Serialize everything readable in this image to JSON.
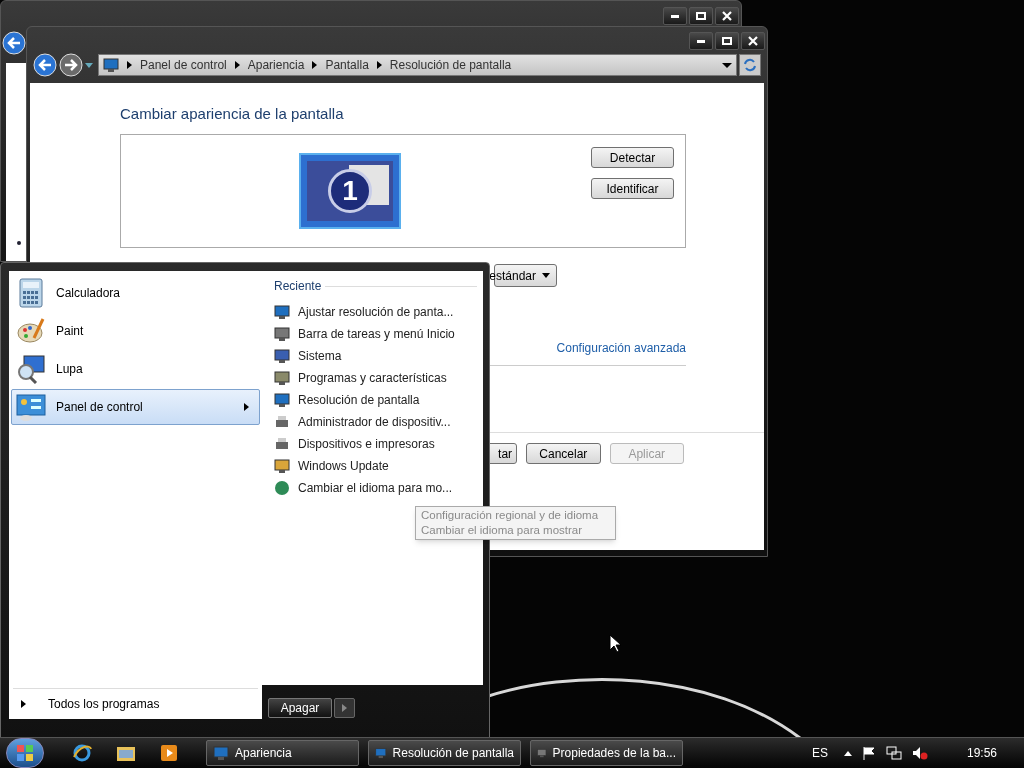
{
  "main_window": {
    "breadcrumb": [
      "Panel de control",
      "Apariencia",
      "Pantalla",
      "Resolución de pantalla"
    ],
    "heading": "Cambiar apariencia de la pantalla",
    "monitor_number": "1",
    "side_buttons": [
      "Detectar",
      "Identificar"
    ],
    "dropdown_value": "estándar",
    "link": "Configuración avanzada",
    "buttons": [
      {
        "label": "tar",
        "disabled": false
      },
      {
        "label": "Cancelar",
        "disabled": false
      },
      {
        "label": "Aplicar",
        "disabled": true
      }
    ]
  },
  "start_menu": {
    "pinned": [
      {
        "label": "Calculadora",
        "selected": false,
        "kind": "calculator"
      },
      {
        "label": "Paint",
        "selected": false,
        "kind": "paint"
      },
      {
        "label": "Lupa",
        "selected": false,
        "kind": "magnifier"
      },
      {
        "label": "Panel de control",
        "selected": true,
        "kind": "control"
      }
    ],
    "recent_heading": "Reciente",
    "recent": [
      {
        "label": "Ajustar resolución de panta...",
        "kind": "monitor"
      },
      {
        "label": "Barra de tareas y menú Inicio",
        "kind": "taskbar"
      },
      {
        "label": "Sistema",
        "kind": "system"
      },
      {
        "label": "Programas y características",
        "kind": "programs"
      },
      {
        "label": "Resolución de pantalla",
        "kind": "monitor"
      },
      {
        "label": "Administrador de dispositiv...",
        "kind": "printer"
      },
      {
        "label": "Dispositivos e impresoras",
        "kind": "printer"
      },
      {
        "label": "Windows Update",
        "kind": "update"
      },
      {
        "label": "Cambiar el idioma para mo...",
        "kind": "globe"
      }
    ],
    "all_programs": "Todos los programas",
    "shutdown": "Apagar"
  },
  "tooltip": [
    "Configuración regional y de idioma",
    "Cambiar el idioma para mostrar"
  ],
  "taskbar": {
    "tasks": [
      {
        "label": "Apariencia",
        "selected": false
      },
      {
        "label": "Resolución de pantalla",
        "selected": false
      },
      {
        "label": "Propiedades de la ba...",
        "selected": false
      }
    ],
    "language": "ES",
    "clock": "19:56"
  }
}
